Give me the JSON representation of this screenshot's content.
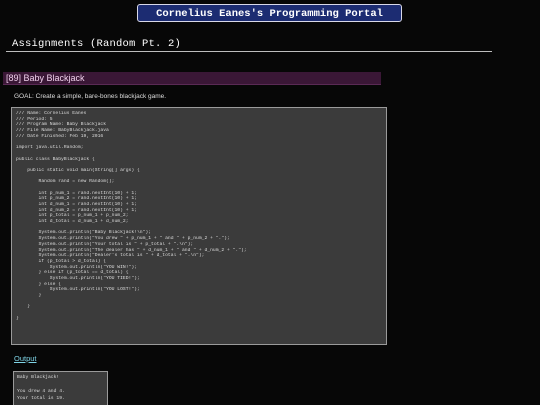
{
  "header": {
    "portal_title": "Cornelius Eanes's Programming Portal",
    "page_title": "Assignments (Random Pt. 2)"
  },
  "assignment": {
    "title": "[89] Baby Blackjack",
    "goal": "GOAL: Create a simple, bare-bones blackjack game.",
    "code_lines": [
      "/// Name: Cornelius Eanes",
      "/// Period: 5",
      "/// Program Name: Baby Blackjack",
      "/// File Name: BabyBlackjack.java",
      "/// Date Finished: Feb 19, 2016",
      "",
      "import java.util.Random;",
      "",
      "public class BabyBlackjack {",
      "",
      "    public static void main(String[] args) {",
      "",
      "        Random rand = new Random();",
      "",
      "        int p_num_1 = rand.nextInt(10) + 1;",
      "        int p_num_2 = rand.nextInt(10) + 1;",
      "        int d_num_1 = rand.nextInt(10) + 1;",
      "        int d_num_2 = rand.nextInt(10) + 1;",
      "        int p_total = p_num_1 + p_num_2;",
      "        int d_total = d_num_1 + d_num_2;",
      "",
      "        System.out.println(\"Baby Blackjack!\\n\");",
      "        System.out.println(\"You drew \" + p_num_1 + \" and \" + p_num_2 + \".\");",
      "        System.out.println(\"Your total is \" + p_total + \".\\n\");",
      "        System.out.println(\"The dealer has \" + d_num_1 + \" and \" + d_num_2 + \".\");",
      "        System.out.println(\"Dealer's total is \" + d_total + \".\\n\");",
      "        if (p_total > d_total) {",
      "            System.out.println(\"YOU WIN!\");",
      "        } else if (p_total == d_total) {",
      "            System.out.println(\"YOU TIED!\");",
      "        } else {",
      "            System.out.println(\"YOU LOST!\");",
      "        }",
      "",
      "    }",
      "",
      "}"
    ]
  },
  "output": {
    "label": "Output",
    "lines": [
      "Baby Blackjack!",
      "",
      "You drew 4 and 4.",
      "Your total is 19."
    ]
  },
  "colors": {
    "banner_bg": "#1c2c72",
    "assignment_header_bg": "#3a1736",
    "code_bg": "#3b3b3b",
    "link": "#7fd4e6"
  }
}
